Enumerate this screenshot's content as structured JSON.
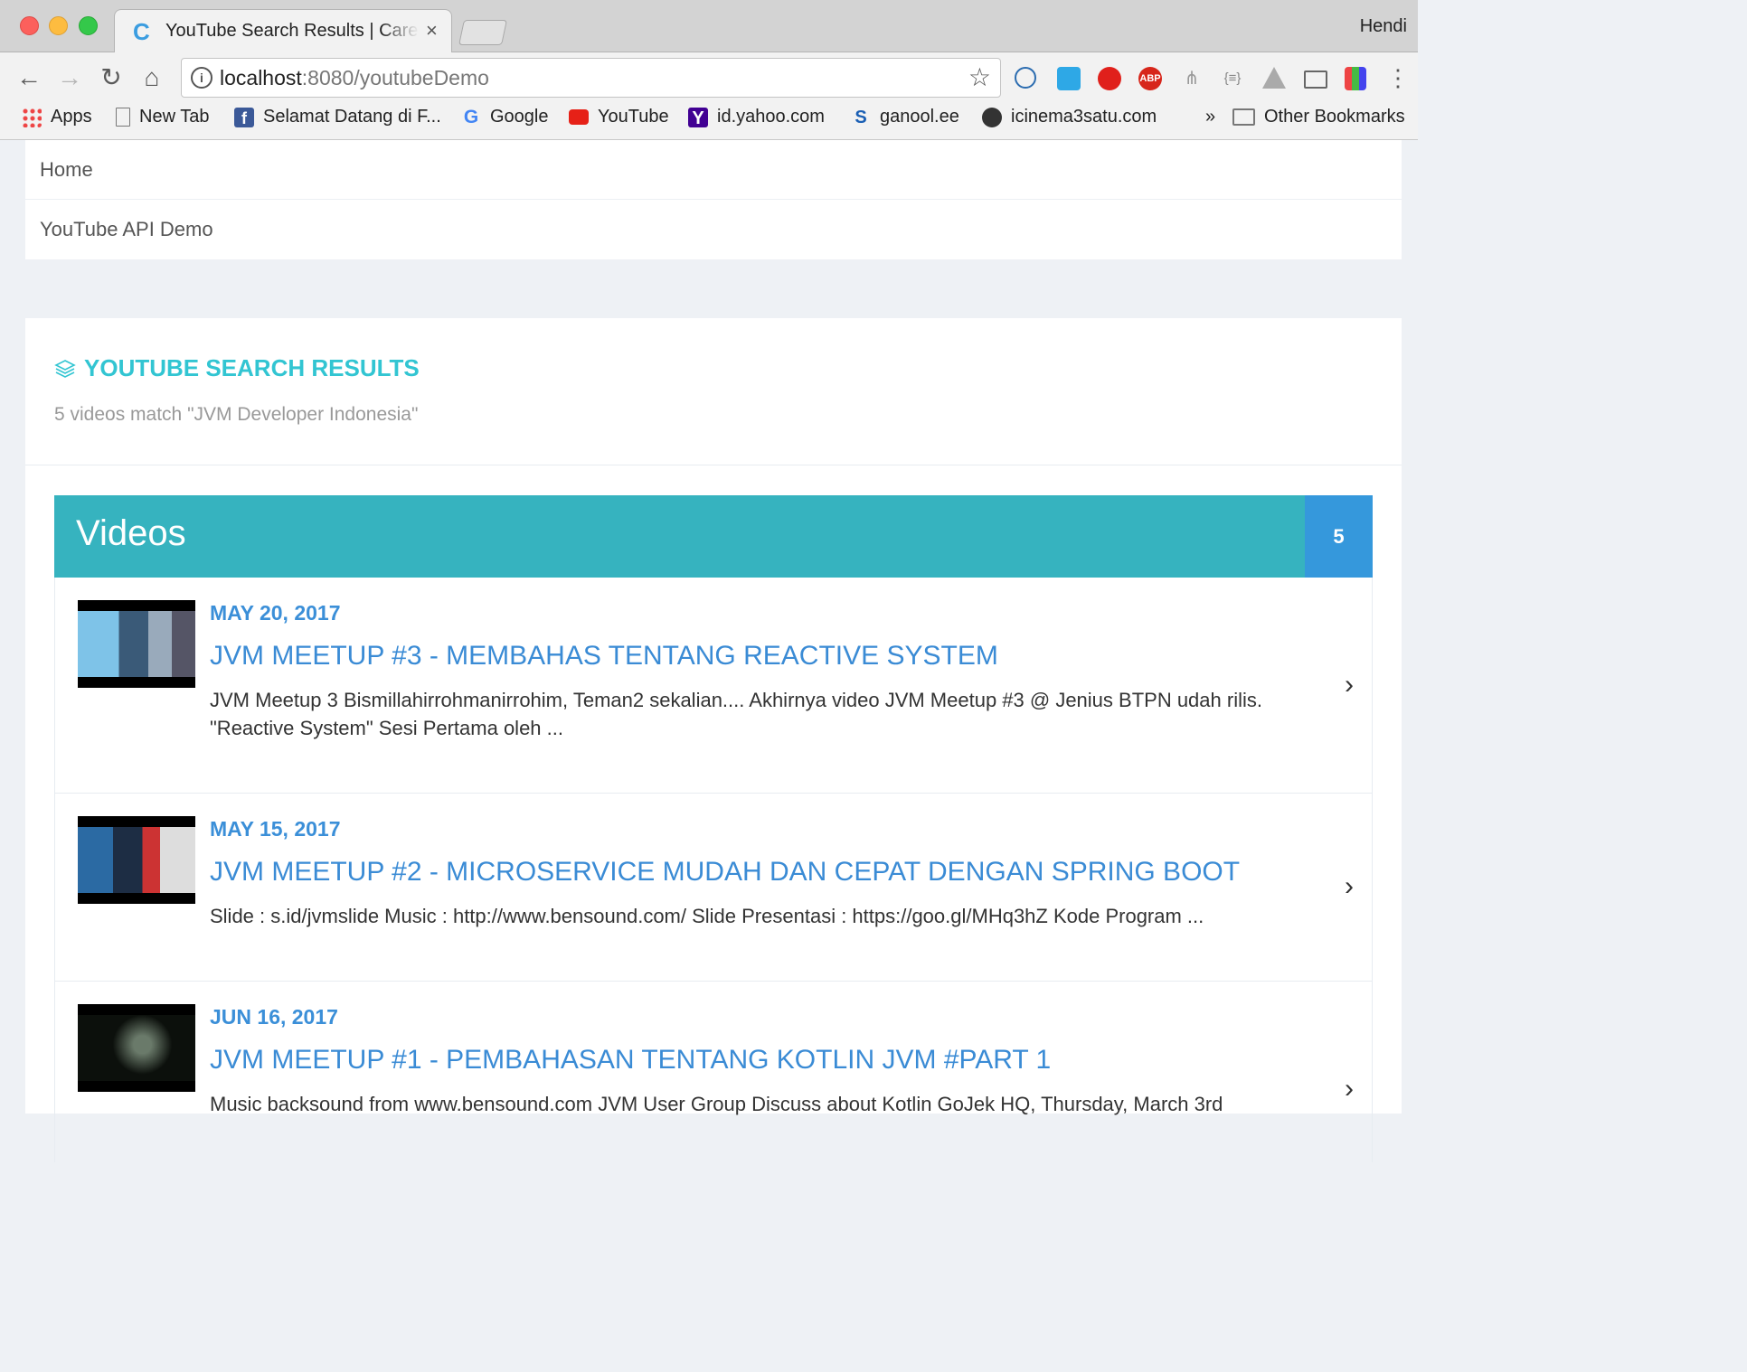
{
  "browser": {
    "tab_title": "YouTube Search Results | Careers",
    "tab_favicon": "C",
    "tab_close": "×",
    "profile_name": "Hendi",
    "url_host": "localhost",
    "url_path": ":8080/youtubeDemo",
    "nav": {
      "back": "←",
      "forward": "→",
      "reload": "↻",
      "home": "⌂"
    },
    "bookmarks": [
      {
        "label": "Apps",
        "icon": "apps-grid-icon",
        "color": "#e44"
      },
      {
        "label": "New Tab",
        "icon": "page-icon",
        "color": "#fff"
      },
      {
        "label": "Selamat Datang di F...",
        "icon": "facebook-icon",
        "color": "#3b5998"
      },
      {
        "label": "Google",
        "icon": "google-icon",
        "color": "#4285f4"
      },
      {
        "label": "YouTube",
        "icon": "youtube-icon",
        "color": "#e62117"
      },
      {
        "label": "id.yahoo.com",
        "icon": "yahoo-icon",
        "color": "#410093"
      },
      {
        "label": "ganool.ee",
        "icon": "ganool-icon",
        "color": "#1a5fb4"
      },
      {
        "label": "icinema3satu.com",
        "icon": "c31-icon",
        "color": "#333"
      }
    ],
    "bookmarks_overflow": "»",
    "other_bookmarks": "Other Bookmarks"
  },
  "topnav": {
    "items": [
      "Home",
      "YouTube API Demo"
    ]
  },
  "panel": {
    "title": "YouTube Search Results",
    "subtitle": "5 videos match \"JVM Developer Indonesia\"",
    "accent_color": "#32c5d2"
  },
  "videos": {
    "heading": "Videos",
    "count": "5",
    "items": [
      {
        "date": "MAY 20, 2017",
        "title": "JVM Meetup #3 - Membahas Tentang Reactive System",
        "description": "JVM Meetup 3 Bismillahirrohmanirrohim, Teman2 sekalian.... Akhirnya video JVM Meetup #3 @ Jenius BTPN udah rilis. \"Reactive System\" Sesi Pertama oleh ..."
      },
      {
        "date": "MAY 15, 2017",
        "title": "JVM Meetup #2 - Microservice Mudah dan Cepat dengan Spring Boot",
        "description": "Slide : s.id/jvmslide Music : http://www.bensound.com/ Slide Presentasi : https://goo.gl/MHq3hZ Kode Program ..."
      },
      {
        "date": "JUN 16, 2017",
        "title": "JVM Meetup #1 - Pembahasan Tentang Kotlin JVM #Part 1",
        "description": "Music backsound from www.bensound.com JVM User Group Discuss about Kotlin GoJek HQ, Thursday, March 3rd"
      }
    ]
  }
}
